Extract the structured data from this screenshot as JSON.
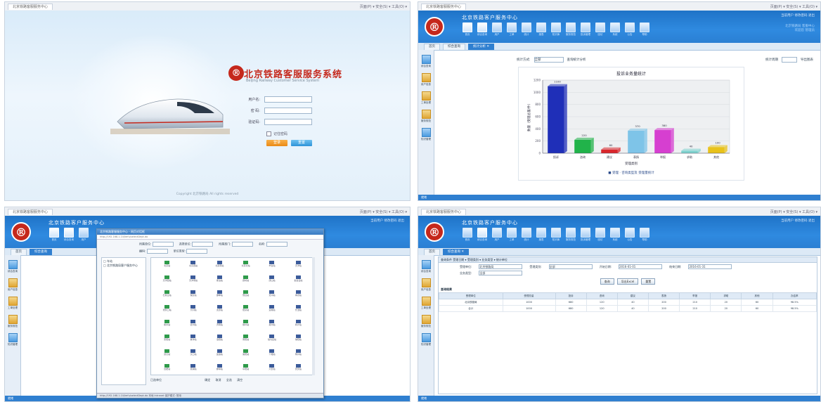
{
  "browser": {
    "tab_label": "北京铁路客服服务中心",
    "toolbar_text": "页面(P) ▾  安全(S) ▾  工具(O) ▾"
  },
  "login": {
    "logo_char": "®",
    "title": "北京铁路客服服务系统",
    "subtitle": "Beijing Railway Customer Service System",
    "username_label": "用户名:",
    "password_label": "密 码:",
    "captcha_label": "验证码:",
    "remember_label": "记住密码",
    "login_button": "登录",
    "reset_button": "重置",
    "copyright": "Copyright 北京铁路局 All rights reserved"
  },
  "app": {
    "logo_char": "®",
    "title": "北京铁路客户服务中心",
    "header_links": "当前用户  修改密码  退出",
    "header_info": [
      "北京铁路局 客服中心",
      "欢迎您 管理员"
    ],
    "nav_icons": [
      "首页",
      "综合查询",
      "用户",
      "工单",
      "统计",
      "报表",
      "知识库",
      "服务规范",
      "投诉管理",
      "回访",
      "系统",
      "公告",
      "帮助"
    ],
    "side_items": [
      "综合查询",
      "用户信息",
      "工单处理",
      "服务规范",
      "知识管理"
    ],
    "status_text": "就绪"
  },
  "q2": {
    "tabs": [
      "首页",
      "综合查询",
      "统计分析 ✕"
    ],
    "filter_label": "统计方式:",
    "filter_value": "全部",
    "filter_button": "查询统计分析",
    "filter_right_label": "统计周期",
    "filter_right_button": "导出图表"
  },
  "chart_data": {
    "type": "bar",
    "title": "投诉业务量统计",
    "xlabel": "受理类别",
    "ylabel": "数量（受理总量/件）",
    "categories": [
      "投诉",
      "咨询",
      "建议",
      "表扬",
      "举报",
      "求助",
      "其他"
    ],
    "values": [
      1100,
      220,
      60,
      370,
      380,
      40,
      100
    ],
    "colors": [
      "#1f2fb8",
      "#21b34a",
      "#d9262b",
      "#7ec4e8",
      "#d63fd0",
      "#7fd3cf",
      "#e8c21a"
    ],
    "ylim": [
      0,
      1200
    ],
    "yticks": [
      0,
      200,
      400,
      600,
      800,
      1000,
      1200
    ],
    "legend": "■ 受理 · 咨询类型及 受理量统计"
  },
  "q3": {
    "tabs": [
      "首页",
      "综合查询"
    ],
    "dialog_title": "北京铁路客服服务中心 - 网页对话框",
    "dialog_address": "http://192.168.1.10/kefu/selectDept.do",
    "filter_labels": [
      "所属单位:",
      "选择单位:",
      "所属部门:",
      "名称:",
      "编码:",
      "单位类型:"
    ],
    "tree_items": [
      "□ 车站",
      "  □ 北京铁路局客户服务中心"
    ],
    "grid_items": [
      "北京站",
      "北京西站",
      "北京南站",
      "北京北站",
      "丰台站",
      "天津站",
      "天津西站",
      "天津南站",
      "塘沽站",
      "廊坊站",
      "唐山站",
      "秦皇岛站",
      "石家庄站",
      "保定站",
      "邯郸站",
      "邢台站",
      "沧州站",
      "承德站",
      "张家口站",
      "大同站",
      "太原站",
      "阳泉站",
      "运城站",
      "长治站",
      "衡水站",
      "德州站",
      "济南站",
      "徐州站",
      "郑州站",
      "新乡站",
      "安阳站",
      "焦作站",
      "洛阳站",
      "南阳站",
      "驻马店站",
      "信阳站",
      "武汉站",
      "汉口站",
      "宜昌站",
      "襄阳站",
      "十堰站",
      "荆州站",
      "合肥站",
      "芜湖站",
      "蚌埠站",
      "阜阳站",
      "六安站",
      "安庆站"
    ],
    "bottom_labels": [
      "已选单位",
      "确定",
      "取消",
      "全选",
      "清空"
    ],
    "status_text": "http://192.168.1.10/kefu/selectDept.do   本地 Intranet   保护模式: 禁用"
  },
  "q4": {
    "tabs": [
      "首页",
      "综合查询 ✕"
    ],
    "panel_head": "查询条件  受理日期  ▾ 受理类别  ▾ 业务类型 ▾  统计单位",
    "row1": [
      "受理单位:",
      "北京铁路局",
      "受理类别:",
      "全部",
      "开始日期:",
      "2016-01-01",
      "结束日期:",
      "2016-01-31"
    ],
    "row2": [
      "业务类型:",
      "全部"
    ],
    "buttons": [
      "查询",
      "导出Excel",
      "重置"
    ],
    "result_title": "查询结果",
    "columns": [
      "受理单位",
      "受理总量",
      "投诉",
      "咨询",
      "建议",
      "表扬",
      "举报",
      "求助",
      "其他",
      "办结率"
    ],
    "rows": [
      [
        "北京铁路局",
        "1000",
        "680",
        "120",
        "40",
        "200",
        "210",
        "20",
        "60",
        "98.5%"
      ],
      [
        "合计",
        "1000",
        "680",
        "120",
        "40",
        "200",
        "210",
        "20",
        "60",
        "98.5%"
      ]
    ]
  }
}
